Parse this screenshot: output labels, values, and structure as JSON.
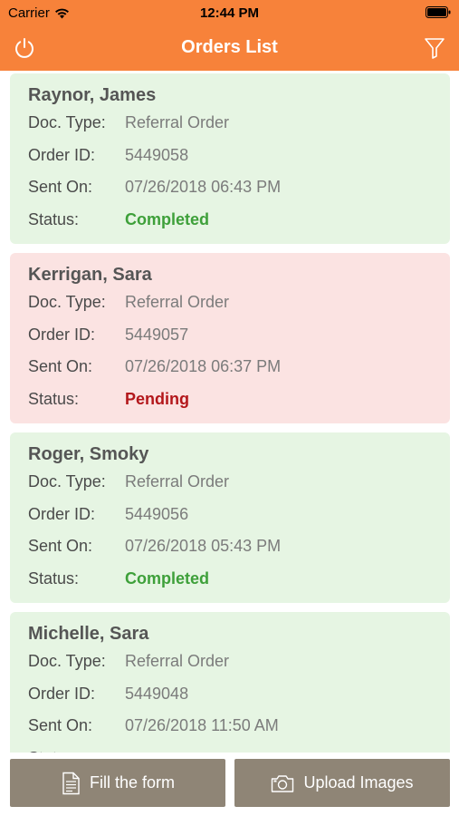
{
  "status_bar": {
    "carrier": "Carrier",
    "time": "12:44 PM"
  },
  "nav": {
    "title": "Orders List",
    "left_icon": "power-icon",
    "right_icon": "filter-icon",
    "background": "#f7823a"
  },
  "labels": {
    "doc_type": "Doc. Type:",
    "order_id": "Order ID:",
    "sent_on": "Sent On:",
    "status": "Status:"
  },
  "orders": [
    {
      "name": "Raynor, James",
      "doc_type": "Referral Order",
      "order_id": "5449058",
      "sent_on": "07/26/2018 06:43 PM",
      "status": "Completed"
    },
    {
      "name": "Kerrigan, Sara",
      "doc_type": "Referral Order",
      "order_id": "5449057",
      "sent_on": "07/26/2018 06:37 PM",
      "status": "Pending"
    },
    {
      "name": "Roger, Smoky",
      "doc_type": "Referral Order",
      "order_id": "5449056",
      "sent_on": "07/26/2018 05:43 PM",
      "status": "Completed"
    },
    {
      "name": "Michelle, Sara",
      "doc_type": "Referral Order",
      "order_id": "5449048",
      "sent_on": "07/26/2018 11:50 AM",
      "status": ""
    }
  ],
  "buttons": {
    "fill_form": "Fill the form",
    "upload_images": "Upload Images"
  },
  "colors": {
    "completed_bg": "#e6f5e3",
    "pending_bg": "#fbe3e2",
    "completed_text": "#3ea03a",
    "pending_text": "#b3171b",
    "button_bg": "#8f8576"
  }
}
